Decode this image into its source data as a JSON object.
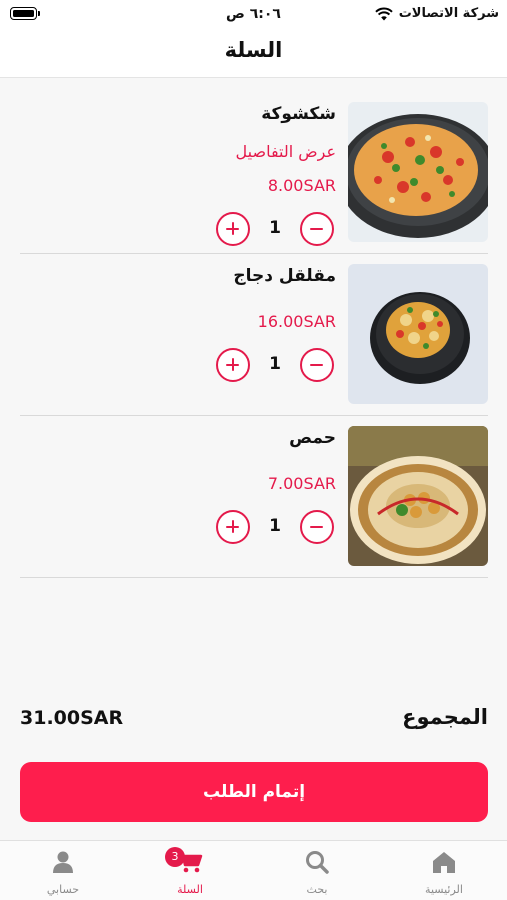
{
  "status_bar": {
    "time": "٦:٠٦ ص",
    "carrier": "شركة الاتصالات"
  },
  "header": {
    "title": "السلة"
  },
  "cart": {
    "items": [
      {
        "name": "شكشوكة",
        "details_link": "عرض التفاصيل",
        "price": "8.00SAR",
        "quantity": "1",
        "image": "shakshuka-dish"
      },
      {
        "name": "مقلقل دجاج",
        "price": "16.00SAR",
        "quantity": "1",
        "image": "chicken-dish"
      },
      {
        "name": "حمص",
        "price": "7.00SAR",
        "quantity": "1",
        "image": "hummus-dish"
      }
    ]
  },
  "summary": {
    "total_label": "المجموع",
    "total_value": "31.00SAR"
  },
  "checkout_button": {
    "label": "إتمام الطلب"
  },
  "tab_bar": {
    "tabs": [
      {
        "label": "الرئيسية",
        "icon": "home-icon"
      },
      {
        "label": "بحث",
        "icon": "search-icon"
      },
      {
        "label": "السلة",
        "icon": "cart-icon",
        "badge": "3",
        "active": true
      },
      {
        "label": "حسابي",
        "icon": "user-icon"
      }
    ]
  },
  "colors": {
    "accent": "#e41a4b",
    "checkout": "#fe1e4d",
    "background": "#f7f7f7"
  }
}
